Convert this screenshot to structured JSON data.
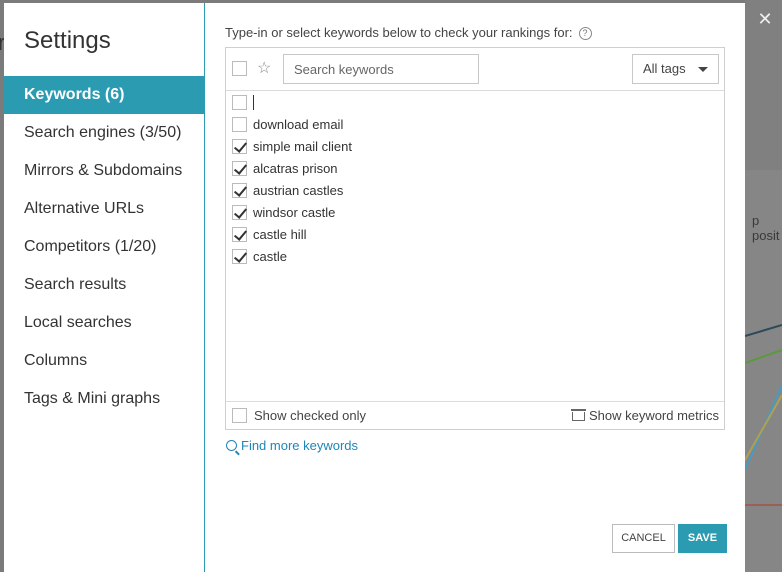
{
  "background": {
    "partial_text_left": "r",
    "partial_text_right": "p posit",
    "close_icon": "close-icon"
  },
  "sidebar": {
    "title": "Settings",
    "items": [
      {
        "label": "Keywords (6)",
        "active": true
      },
      {
        "label": "Search engines (3/50)"
      },
      {
        "label": "Mirrors & Subdomains"
      },
      {
        "label": "Alternative URLs"
      },
      {
        "label": "Competitors (1/20)"
      },
      {
        "label": "Search results"
      },
      {
        "label": "Local searches"
      },
      {
        "label": "Columns"
      },
      {
        "label": "Tags & Mini graphs"
      }
    ]
  },
  "keywords": {
    "hint": "Type-in or select keywords below to check your rankings for:",
    "search_placeholder": "Search keywords",
    "tags_select": "All tags",
    "list": [
      {
        "label": "",
        "checked": false
      },
      {
        "label": "download email",
        "checked": false
      },
      {
        "label": "simple mail client",
        "checked": true
      },
      {
        "label": "alcatras prison",
        "checked": true
      },
      {
        "label": "austrian castles",
        "checked": true
      },
      {
        "label": "windsor castle",
        "checked": true
      },
      {
        "label": "castle hill",
        "checked": true
      },
      {
        "label": "castle",
        "checked": true
      }
    ],
    "show_checked_only": "Show checked only",
    "show_metrics": "Show keyword metrics",
    "find_more": "Find more keywords"
  },
  "buttons": {
    "cancel": "CANCEL",
    "save": "SAVE"
  },
  "colors": {
    "accent": "#2a9bb0",
    "link": "#1f86b8"
  }
}
